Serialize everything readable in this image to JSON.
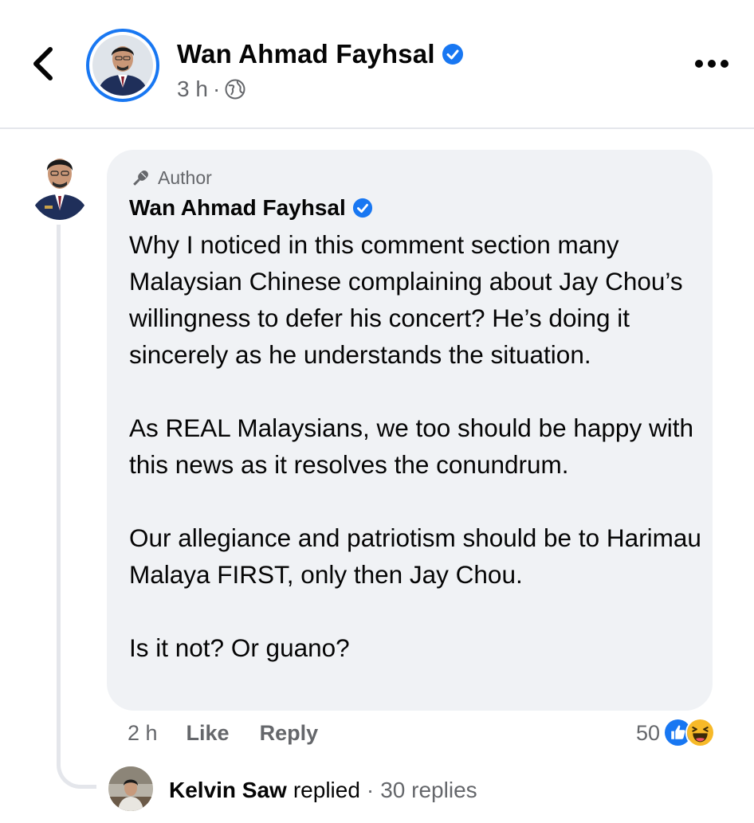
{
  "header": {
    "back_icon": "chevron-left-icon",
    "name": "Wan Ahmad Fayhsal",
    "verified_icon": "verified-badge-icon",
    "time": "3 h",
    "separator": "·",
    "audience_icon": "globe-icon",
    "more_icon": "more-horizontal-icon"
  },
  "comment": {
    "badge_icon": "microphone-icon",
    "badge_label": "Author",
    "author": "Wan Ahmad Fayhsal",
    "paragraphs": [
      "Why I noticed in this comment section many Malaysian Chinese complaining about Jay Chou’s willingness to defer his concert? He’s doing it sincerely as he understands the situation.",
      "As REAL Malaysians, we too should be happy with this news as it resolves the conundrum.",
      "Our allegiance and patriotism should be to Harimau Malaya FIRST, only then Jay Chou.",
      "Is it not? Or guano?"
    ],
    "time": "2 h",
    "like_label": "Like",
    "reply_label": "Reply",
    "reaction_count": "50",
    "reaction_icons": [
      "like-reaction-icon",
      "haha-reaction-icon"
    ]
  },
  "replies": {
    "name": "Kelvin Saw",
    "verb": "replied",
    "separator": "·",
    "count_label": "30 replies"
  },
  "colors": {
    "accent": "#1877f2",
    "bubble": "#f0f2f5",
    "secondary_text": "#65676b",
    "haha": "#f7b928"
  }
}
